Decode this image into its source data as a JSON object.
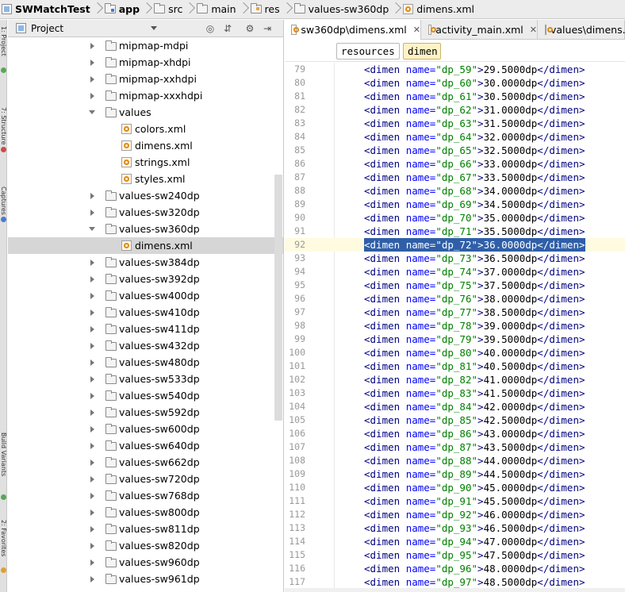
{
  "navbar": {
    "crumbs": [
      {
        "label": "SWMatchTest",
        "icon": "project-icon",
        "bold": true
      },
      {
        "label": "app",
        "icon": "module-folder-icon",
        "bold": true
      },
      {
        "label": "src",
        "icon": "folder-icon",
        "bold": false
      },
      {
        "label": "main",
        "icon": "folder-icon",
        "bold": false
      },
      {
        "label": "res",
        "icon": "res-folder-icon",
        "bold": false
      },
      {
        "label": "values-sw360dp",
        "icon": "folder-icon",
        "bold": false
      },
      {
        "label": "dimens.xml",
        "icon": "xml-file-icon",
        "bold": false
      }
    ]
  },
  "tool_strip": {
    "top_tabs": [
      "1: Project",
      "7: Structure",
      "Captures"
    ],
    "bottom_tabs": [
      "Build Variants",
      "2: Favorites"
    ]
  },
  "project_panel": {
    "title": "Project",
    "header_icons": [
      "globe-icon",
      "collapse-icon",
      "gear-icon",
      "hide-icon"
    ],
    "tree": [
      {
        "label": "mipmap-mdpi",
        "type": "folder",
        "state": "collapsed"
      },
      {
        "label": "mipmap-xhdpi",
        "type": "folder",
        "state": "collapsed"
      },
      {
        "label": "mipmap-xxhdpi",
        "type": "folder",
        "state": "collapsed"
      },
      {
        "label": "mipmap-xxxhdpi",
        "type": "folder",
        "state": "collapsed"
      },
      {
        "label": "values",
        "type": "folder",
        "state": "expanded"
      },
      {
        "label": "colors.xml",
        "type": "file",
        "state": "none"
      },
      {
        "label": "dimens.xml",
        "type": "file",
        "state": "none"
      },
      {
        "label": "strings.xml",
        "type": "file",
        "state": "none"
      },
      {
        "label": "styles.xml",
        "type": "file",
        "state": "none"
      },
      {
        "label": "values-sw240dp",
        "type": "folder",
        "state": "collapsed"
      },
      {
        "label": "values-sw320dp",
        "type": "folder",
        "state": "collapsed"
      },
      {
        "label": "values-sw360dp",
        "type": "folder",
        "state": "expanded"
      },
      {
        "label": "dimens.xml",
        "type": "file",
        "state": "selected"
      },
      {
        "label": "values-sw384dp",
        "type": "folder",
        "state": "collapsed"
      },
      {
        "label": "values-sw392dp",
        "type": "folder",
        "state": "collapsed"
      },
      {
        "label": "values-sw400dp",
        "type": "folder",
        "state": "collapsed"
      },
      {
        "label": "values-sw410dp",
        "type": "folder",
        "state": "collapsed"
      },
      {
        "label": "values-sw411dp",
        "type": "folder",
        "state": "collapsed"
      },
      {
        "label": "values-sw432dp",
        "type": "folder",
        "state": "collapsed"
      },
      {
        "label": "values-sw480dp",
        "type": "folder",
        "state": "collapsed"
      },
      {
        "label": "values-sw533dp",
        "type": "folder",
        "state": "collapsed"
      },
      {
        "label": "values-sw540dp",
        "type": "folder",
        "state": "collapsed"
      },
      {
        "label": "values-sw592dp",
        "type": "folder",
        "state": "collapsed"
      },
      {
        "label": "values-sw600dp",
        "type": "folder",
        "state": "collapsed"
      },
      {
        "label": "values-sw640dp",
        "type": "folder",
        "state": "collapsed"
      },
      {
        "label": "values-sw662dp",
        "type": "folder",
        "state": "collapsed"
      },
      {
        "label": "values-sw720dp",
        "type": "folder",
        "state": "collapsed"
      },
      {
        "label": "values-sw768dp",
        "type": "folder",
        "state": "collapsed"
      },
      {
        "label": "values-sw800dp",
        "type": "folder",
        "state": "collapsed"
      },
      {
        "label": "values-sw811dp",
        "type": "folder",
        "state": "collapsed"
      },
      {
        "label": "values-sw820dp",
        "type": "folder",
        "state": "collapsed"
      },
      {
        "label": "values-sw960dp",
        "type": "folder",
        "state": "collapsed"
      },
      {
        "label": "values-sw961dp",
        "type": "folder",
        "state": "collapsed"
      }
    ]
  },
  "editor": {
    "tabs": [
      {
        "label": "sw360dp\\dimens.xml",
        "active": true,
        "closable": true
      },
      {
        "label": "activity_main.xml",
        "active": false,
        "closable": true
      },
      {
        "label": "values\\dimens.",
        "active": false,
        "closable": false
      }
    ],
    "breadcrumbs": [
      "resources",
      "dimen"
    ],
    "lines": [
      {
        "n": "79",
        "name": "dp_59",
        "value": "29.5000dp"
      },
      {
        "n": "80",
        "name": "dp_60",
        "value": "30.0000dp"
      },
      {
        "n": "81",
        "name": "dp_61",
        "value": "30.5000dp"
      },
      {
        "n": "82",
        "name": "dp_62",
        "value": "31.0000dp"
      },
      {
        "n": "83",
        "name": "dp_63",
        "value": "31.5000dp"
      },
      {
        "n": "84",
        "name": "dp_64",
        "value": "32.0000dp"
      },
      {
        "n": "85",
        "name": "dp_65",
        "value": "32.5000dp"
      },
      {
        "n": "86",
        "name": "dp_66",
        "value": "33.0000dp"
      },
      {
        "n": "87",
        "name": "dp_67",
        "value": "33.5000dp"
      },
      {
        "n": "88",
        "name": "dp_68",
        "value": "34.0000dp"
      },
      {
        "n": "89",
        "name": "dp_69",
        "value": "34.5000dp"
      },
      {
        "n": "90",
        "name": "dp_70",
        "value": "35.0000dp"
      },
      {
        "n": "91",
        "name": "dp_71",
        "value": "35.5000dp"
      },
      {
        "n": "92",
        "name": "dp_72",
        "value": "36.0000dp",
        "selected": true
      },
      {
        "n": "93",
        "name": "dp_73",
        "value": "36.5000dp"
      },
      {
        "n": "94",
        "name": "dp_74",
        "value": "37.0000dp"
      },
      {
        "n": "95",
        "name": "dp_75",
        "value": "37.5000dp"
      },
      {
        "n": "96",
        "name": "dp_76",
        "value": "38.0000dp"
      },
      {
        "n": "97",
        "name": "dp_77",
        "value": "38.5000dp"
      },
      {
        "n": "98",
        "name": "dp_78",
        "value": "39.0000dp"
      },
      {
        "n": "99",
        "name": "dp_79",
        "value": "39.5000dp"
      },
      {
        "n": "100",
        "name": "dp_80",
        "value": "40.0000dp"
      },
      {
        "n": "101",
        "name": "dp_81",
        "value": "40.5000dp"
      },
      {
        "n": "102",
        "name": "dp_82",
        "value": "41.0000dp"
      },
      {
        "n": "103",
        "name": "dp_83",
        "value": "41.5000dp"
      },
      {
        "n": "104",
        "name": "dp_84",
        "value": "42.0000dp"
      },
      {
        "n": "105",
        "name": "dp_85",
        "value": "42.5000dp"
      },
      {
        "n": "106",
        "name": "dp_86",
        "value": "43.0000dp"
      },
      {
        "n": "107",
        "name": "dp_87",
        "value": "43.5000dp"
      },
      {
        "n": "108",
        "name": "dp_88",
        "value": "44.0000dp"
      },
      {
        "n": "109",
        "name": "dp_89",
        "value": "44.5000dp"
      },
      {
        "n": "110",
        "name": "dp_90",
        "value": "45.0000dp"
      },
      {
        "n": "111",
        "name": "dp_91",
        "value": "45.5000dp"
      },
      {
        "n": "112",
        "name": "dp_92",
        "value": "46.0000dp"
      },
      {
        "n": "113",
        "name": "dp_93",
        "value": "46.5000dp"
      },
      {
        "n": "114",
        "name": "dp_94",
        "value": "47.0000dp"
      },
      {
        "n": "115",
        "name": "dp_95",
        "value": "47.5000dp"
      },
      {
        "n": "116",
        "name": "dp_96",
        "value": "48.0000dp"
      },
      {
        "n": "117",
        "name": "dp_97",
        "value": "48.5000dp"
      }
    ],
    "tag_open": "<dimen",
    "attr_name": "name=",
    "tag_close": "</dimen>",
    "colors": {
      "tag": "#000080",
      "attr": "#0000ff",
      "value": "#008000",
      "selection": "#2f5fa8"
    }
  }
}
